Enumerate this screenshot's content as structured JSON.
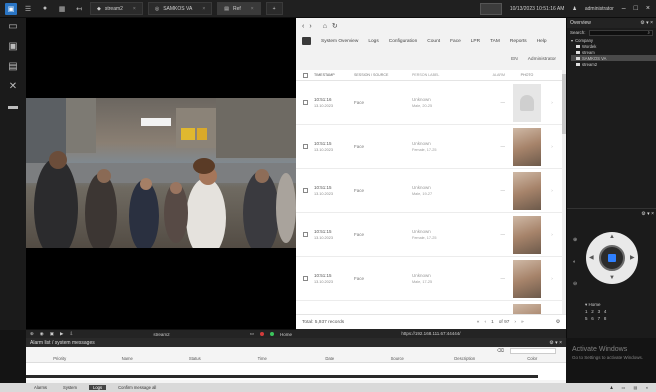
{
  "topbar": {
    "tabs": [
      "stream2",
      "SAMKOS VA",
      "Ref"
    ],
    "datetime": "10/13/2023 10:51:16 AM",
    "user": "administrator"
  },
  "video": {
    "camera_name": "stream2",
    "home_label": "Home"
  },
  "browser": {
    "menu": [
      "System Overview",
      "Logs",
      "Configuration",
      "Count",
      "Face",
      "LPR",
      "TAM",
      "Reports",
      "Help"
    ],
    "lang": "EN",
    "role": "Administrator",
    "columns": [
      "TIMESTAMP",
      "SESSION / SOURCE",
      "PERSON LABEL",
      "ALARM",
      "PHOTO"
    ],
    "rows": [
      {
        "time": "10:51:16",
        "date": "13.10.2023",
        "source": "Face",
        "label": "Unknown",
        "sub": "Male, 20-25",
        "alarm": "—",
        "photo": "blank"
      },
      {
        "time": "10:51:15",
        "date": "13.10.2023",
        "source": "Face",
        "label": "Unknown",
        "sub": "Female, 17-25",
        "alarm": "—",
        "photo": "face"
      },
      {
        "time": "10:51:15",
        "date": "13.10.2023",
        "source": "Face",
        "label": "Unknown",
        "sub": "Male, 19-27",
        "alarm": "—",
        "photo": "face"
      },
      {
        "time": "10:51:15",
        "date": "13.10.2023",
        "source": "Face",
        "label": "Unknown",
        "sub": "Female, 17-25",
        "alarm": "—",
        "photo": "face"
      },
      {
        "time": "10:51:15",
        "date": "13.10.2023",
        "source": "Face",
        "label": "Unknown",
        "sub": "Male, 17-25",
        "alarm": "—",
        "photo": "face"
      },
      {
        "time": "10:51:15",
        "date": "13.10.2023",
        "source": "Face",
        "label": "Unknown",
        "sub": "Male, 27-35",
        "alarm": "—",
        "photo": "face"
      }
    ],
    "total": "Total: 5,937 records",
    "pager": [
      "«",
      "‹",
      "1",
      "of 97",
      "›",
      "»"
    ],
    "url": "https://192.168.111.67:44444/"
  },
  "right": {
    "overview_title": "Overview",
    "search_label": "Search:",
    "tree": [
      "Company",
      "Wordek",
      "stream",
      "SAMKOS VA",
      "stream2"
    ],
    "presets_label": "Home",
    "presets_row1": [
      "1",
      "2",
      "3",
      "4"
    ],
    "presets_row2": [
      "5",
      "6",
      "7",
      "8"
    ]
  },
  "alarm": {
    "title": "Alarm list / system messages",
    "columns": [
      "Priority",
      "Name",
      "Status",
      "Time",
      "Date",
      "Source",
      "Description",
      "Color"
    ]
  },
  "statusbar": {
    "tabs": [
      "Alarms",
      "System",
      "Logs",
      "Confirm message all"
    ],
    "active_index": 2
  },
  "watermark": {
    "line1": "Activate Windows",
    "line2": "Go to Settings to activate Windows."
  }
}
